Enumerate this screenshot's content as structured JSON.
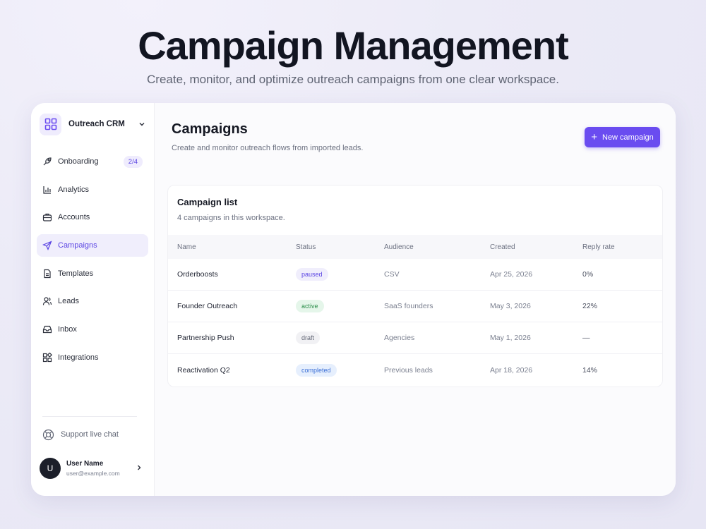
{
  "hero": {
    "title": "Campaign Management",
    "subtitle": "Create, monitor, and optimize outreach campaigns from one clear workspace."
  },
  "sidebar": {
    "brand": "Outreach CRM",
    "items": [
      {
        "label": "Onboarding",
        "icon": "rocket-icon",
        "badge": "2/4"
      },
      {
        "label": "Analytics",
        "icon": "bar-chart-icon"
      },
      {
        "label": "Accounts",
        "icon": "briefcase-icon"
      },
      {
        "label": "Campaigns",
        "icon": "send-icon",
        "active": true
      },
      {
        "label": "Templates",
        "icon": "document-icon"
      },
      {
        "label": "Leads",
        "icon": "users-icon"
      },
      {
        "label": "Inbox",
        "icon": "inbox-icon"
      },
      {
        "label": "Integrations",
        "icon": "puzzle-icon"
      }
    ],
    "support": "Support live chat",
    "user": {
      "initial": "U",
      "name": "User Name",
      "email": "user@example.com"
    }
  },
  "main": {
    "title": "Campaigns",
    "subtitle": "Create and monitor outreach flows from imported leads.",
    "new_button": "New campaign",
    "card": {
      "title": "Campaign list",
      "subtitle": "4 campaigns in this workspace.",
      "columns": [
        "Name",
        "Status",
        "Audience",
        "Created",
        "Reply rate"
      ],
      "rows": [
        {
          "name": "Orderboosts",
          "status": "paused",
          "audience": "CSV",
          "created": "Apr 25, 2026",
          "reply": "0%"
        },
        {
          "name": "Founder Outreach",
          "status": "active",
          "audience": "SaaS founders",
          "created": "May 3, 2026",
          "reply": "22%"
        },
        {
          "name": "Partnership Push",
          "status": "draft",
          "audience": "Agencies",
          "created": "May 1, 2026",
          "reply": "—"
        },
        {
          "name": "Reactivation Q2",
          "status": "completed",
          "audience": "Previous leads",
          "created": "Apr 18, 2026",
          "reply": "14%"
        }
      ]
    }
  },
  "colors": {
    "accent": "#6a4cf0",
    "active_bg": "#f0eefc"
  }
}
